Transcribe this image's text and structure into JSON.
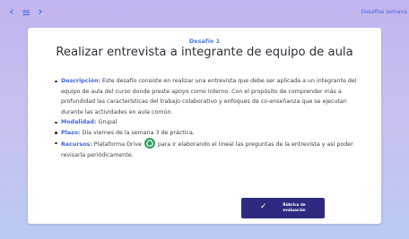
{
  "nav": {
    "back_icon": "‹",
    "menu_icon": "≡",
    "forward_icon": "›",
    "top_link": "Desafíos semana"
  },
  "card": {
    "eyebrow": "Desafío 1",
    "title": "Realizar entrevista a integrante de equipo de aula",
    "items": [
      {
        "label": "Descripción:",
        "text": "Este desafío consiste en realizar una entrevista que debe ser aplicada a un integrante del equipo de aula del curso donde preste apoyo como interno. Con el propósito de comprender más a profundidad las características del trabajo colaborativo y enfoques de co-enseñanza que se ejecutan durante las actividades en aula común."
      },
      {
        "label": "Modalidad:",
        "text": "Grupal"
      },
      {
        "label": "Plazo:",
        "text": "Día viernes de la semana 3 de práctica."
      },
      {
        "label": "Recursos:",
        "text_before": "Plataforma Drive",
        "text_after": "para ir elaborando el lineal las preguntas de la entrevista y así poder revisarla periódicamente.",
        "icon": "google-drive-icon"
      }
    ],
    "rubric_button": {
      "check_icon": "✓",
      "label": "Rúbrica de\nevaluación"
    }
  },
  "colors": {
    "accent": "#3f66e6",
    "button": "#2f2a80",
    "drive": "#2fa05a"
  }
}
